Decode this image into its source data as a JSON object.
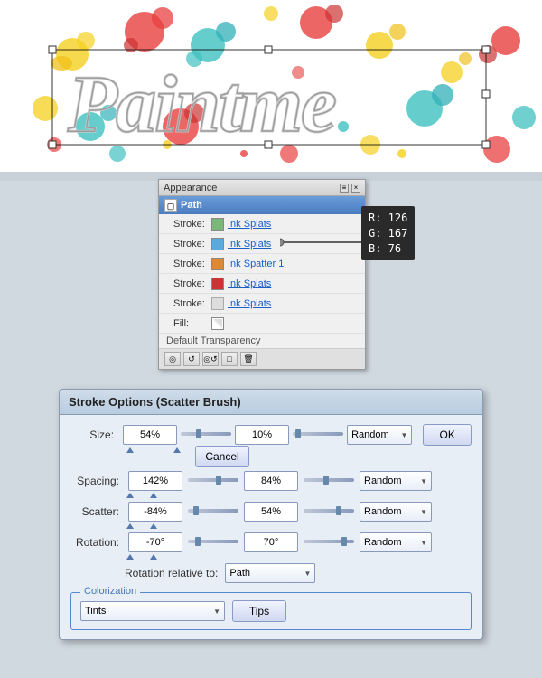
{
  "canvas": {
    "background": "white"
  },
  "appearance_panel": {
    "title": "Appearance",
    "close_btn": "×",
    "minimize_btn": "—",
    "menu_btn": "≡",
    "header_label": "Path",
    "rows": [
      {
        "label": "Stroke:",
        "color": "#7ab87a",
        "name": "Ink Splats"
      },
      {
        "label": "Stroke:",
        "color": "#5baadd",
        "name": "Ink Splats"
      },
      {
        "label": "Stroke:",
        "color": "#dd8833",
        "name": "Ink Spatter 1"
      },
      {
        "label": "Stroke:",
        "color": "#cc3333",
        "name": "Ink Splats"
      },
      {
        "label": "Stroke:",
        "color": "#dddddd",
        "name": "Ink Splats"
      },
      {
        "label": "Fill:",
        "color": null,
        "name": null
      }
    ],
    "footer": "Default Transparency"
  },
  "color_tooltip": {
    "r_label": "R:",
    "r_value": "126",
    "g_label": "G:",
    "g_value": "167",
    "b_label": "B:",
    "b_value": " 76"
  },
  "stroke_options": {
    "title": "Stroke Options (Scatter Brush)",
    "size_label": "Size:",
    "size_val1": "54%",
    "size_val2": "10%",
    "size_dropdown": "Random",
    "spacing_label": "Spacing:",
    "spacing_val1": "142%",
    "spacing_val2": "84%",
    "spacing_dropdown": "Random",
    "scatter_label": "Scatter:",
    "scatter_val1": "-84%",
    "scatter_val2": "54%",
    "scatter_dropdown": "Random",
    "rotation_label": "Rotation:",
    "rotation_val1": "-70°",
    "rotation_val2": "70°",
    "rotation_dropdown": "Random",
    "relative_label": "Rotation relative to:",
    "relative_dropdown": "Path",
    "colorization_label": "Colorization",
    "colorization_dropdown": "Tints",
    "ok_label": "OK",
    "cancel_label": "Cancel",
    "tips_label": "Tips"
  }
}
